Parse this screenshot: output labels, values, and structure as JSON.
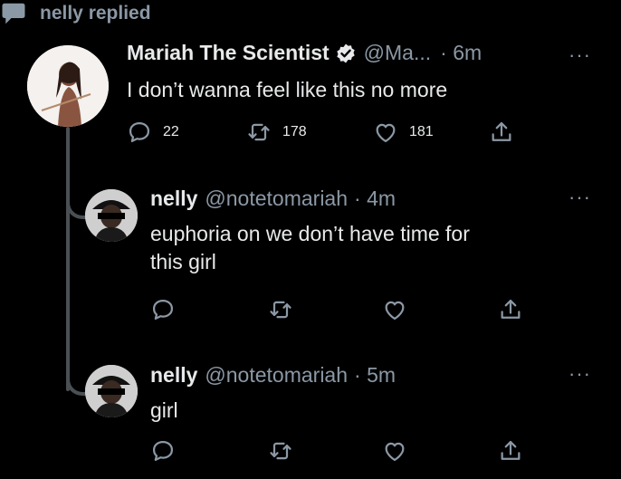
{
  "context": {
    "label": "nelly replied",
    "icon": "speech-bubble-icon"
  },
  "main_tweet": {
    "name": "Mariah The Scientist",
    "handle": "@Ma...",
    "time": "· 6m",
    "text": "I don’t wanna feel like this no more",
    "reply_count": "22",
    "retweet_count": "178",
    "like_count": "181"
  },
  "replies": [
    {
      "name": "nelly",
      "handle": "@notetomariah",
      "time": "· 4m",
      "text_line1": "euphoria on we don’t have time for",
      "text_line2": "this girl"
    },
    {
      "name": "nelly",
      "handle": "@notetomariah",
      "time": "· 5m",
      "text_line1": "girl"
    }
  ],
  "more_label": "···",
  "colors": {
    "background": "#000000",
    "text": "#e7e9ea",
    "muted": "#8b98a5",
    "line": "#4a4f54"
  }
}
